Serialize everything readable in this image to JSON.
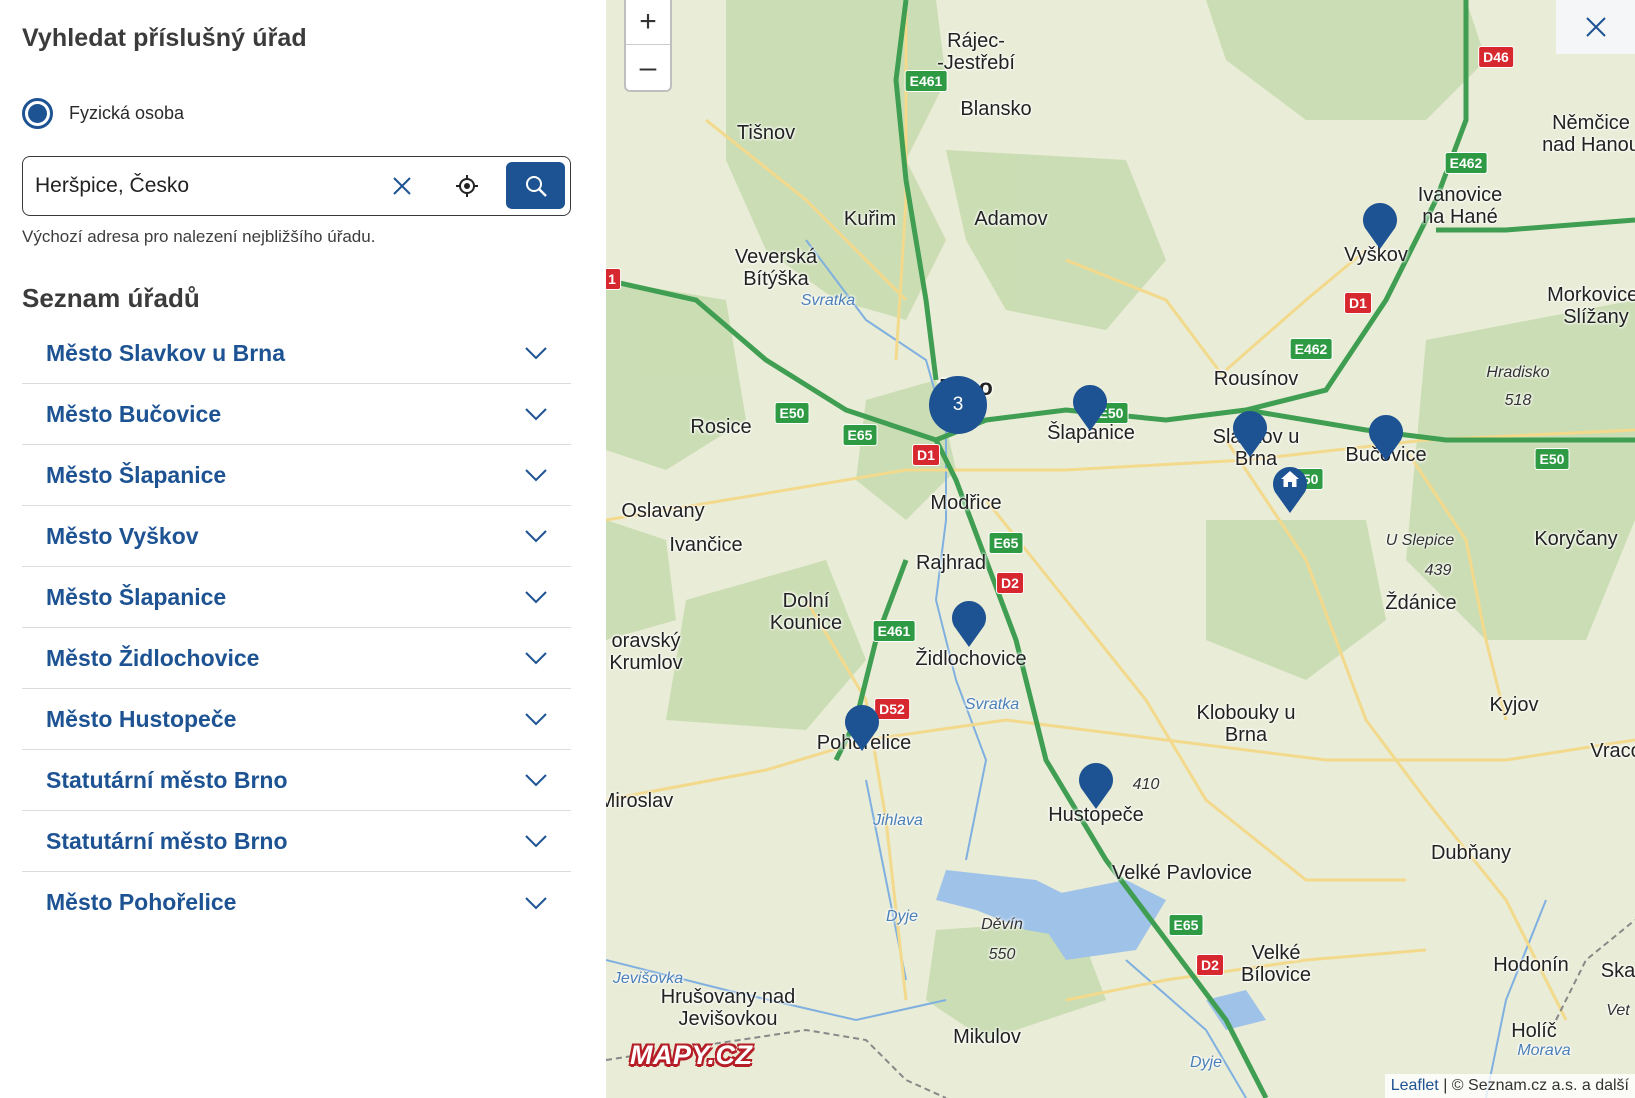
{
  "panel": {
    "title": "Vyhledat příslušný úřad",
    "radio_label": "Fyzická osoba",
    "search_value": "Heršpice, Česko",
    "helper": "Výchozí adresa pro nalezení nejbližšího úřadu.",
    "list_title": "Seznam úřadů",
    "offices": [
      "Město Slavkov u Brna",
      "Město Bučovice",
      "Město Šlapanice",
      "Město Vyškov",
      "Město Šlapanice",
      "Město Židlochovice",
      "Město Hustopeče",
      "Statutární město Brno",
      "Statutární město Brno",
      "Město Pohořelice"
    ]
  },
  "map": {
    "zoom_in": "+",
    "zoom_out": "–",
    "cluster_count": "3",
    "logo": "MAPY.CZ",
    "attribution_leaflet": "Leaflet",
    "attribution_rest": "| © Seznam.cz a.s. a další",
    "places": {
      "rajec": "Rájec-\n-Jestřebí",
      "blansko": "Blansko",
      "tisnov": "Tišnov",
      "kurim": "Kuřim",
      "adamov": "Adamov",
      "veverska": "Veverská Bítýška",
      "rosice": "Rosice",
      "brno": "Brno",
      "slapanice": "Šlapanice",
      "slavkov": "Slavkov u Brna",
      "bucovice": "Bučovice",
      "vyskov": "Vyškov",
      "ivanovice": "Ivanovice na Hané",
      "nemcice": "Němčice nad Hanou",
      "morkovice": "Morkovice-Slížany",
      "rousinov": "Rousínov",
      "hradisko": "Hradisko",
      "hradisko_alt": "518",
      "modrice": "Modřice",
      "oslavany": "Oslavany",
      "ivancice": "Ivančice",
      "rajhrad": "Rajhrad",
      "dolni_kounice": "Dolní Kounice",
      "moravsky_krumlov": "oravský Krumlov",
      "zidlochovice": "Židlochovice",
      "u_slepice": "U Slepice",
      "u_slepice_alt": "439",
      "korycany": "Koryčany",
      "zdanice": "Ždánice",
      "kyjov": "Kyjov",
      "vracov": "Vraco",
      "pohorelice": "Pohořelice",
      "klobouky": "Klobouky u Brna",
      "alt_410": "410",
      "miroslav": "Miroslav",
      "hustopece": "Hustopeče",
      "velke_pavlovice": "Velké Pavlovice",
      "dubnany": "Dubňany",
      "devin": "Děvín",
      "devin_alt": "550",
      "hrusovany": "Hrušovany nad Jevišovkou",
      "mikulov": "Mikulov",
      "velke_bilovice": "Velké Bílovice",
      "hodonin": "Hodonín",
      "holic": "Holíč",
      "ska": "Ska",
      "svratka": "Svratka",
      "svratka2": "Svratka",
      "jihlava": "Jihlava",
      "dyje": "Dyje",
      "dyje2": "Dyje",
      "jevisovka": "Jevišovka",
      "morava": "Morava",
      "vete": "Vet"
    },
    "roads": {
      "e461a": "E461",
      "e461b": "E461",
      "e50a": "E50",
      "e50b": "E50",
      "e50c": "E50",
      "e50d": "E50",
      "e65a": "E65",
      "e65b": "E65",
      "e65c": "E65",
      "e462a": "E462",
      "e462b": "E462",
      "d1a": "D1",
      "d1b": "D1",
      "d1c": "1",
      "d2a": "D2",
      "d2b": "D2",
      "d46": "D46",
      "d52": "D52"
    }
  },
  "colors": {
    "primary": "#1d5393",
    "highway": "#2f9a44",
    "road_red": "#d7272f"
  }
}
